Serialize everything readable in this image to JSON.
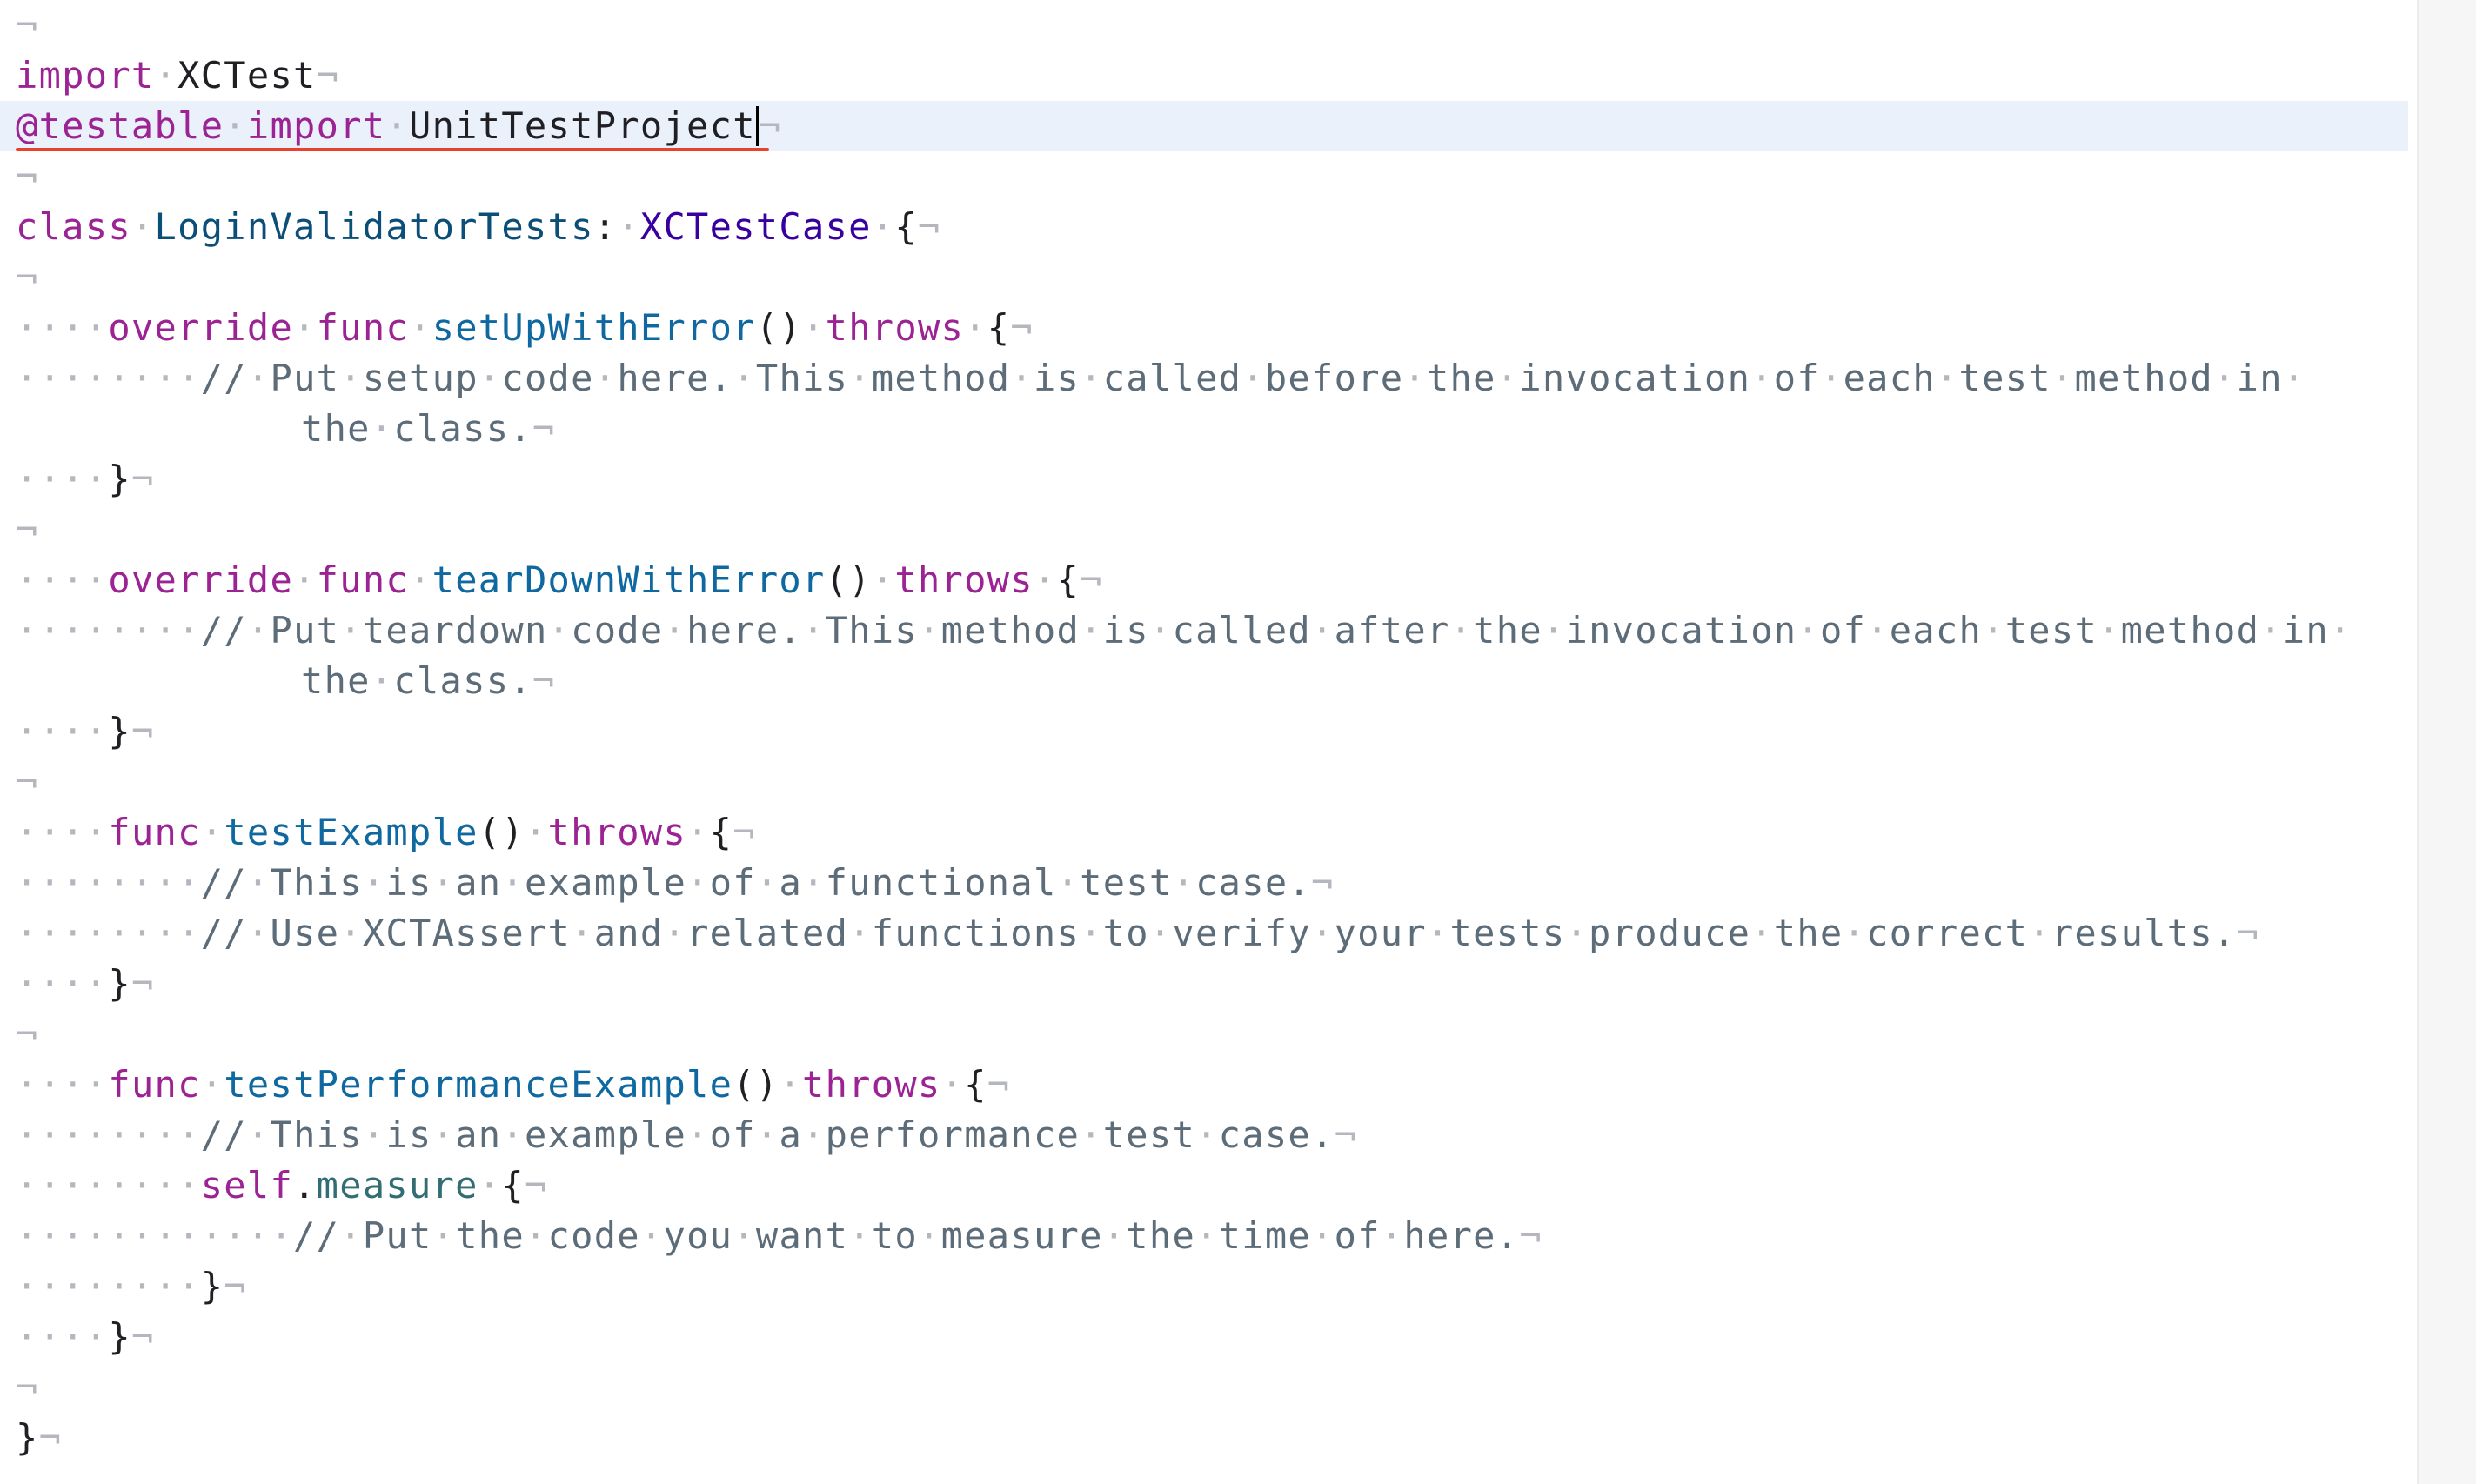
{
  "editor": {
    "file_lines": [
      {
        "id": "l0",
        "tokens": []
      },
      {
        "id": "l1",
        "tokens": [
          [
            "kw",
            "import"
          ],
          [
            "ws",
            "·"
          ],
          [
            "plain",
            "XCTest"
          ]
        ]
      },
      {
        "id": "l2",
        "tokens": [
          [
            "kw",
            "@testable"
          ],
          [
            "ws",
            "·"
          ],
          [
            "kw",
            "import"
          ],
          [
            "ws",
            "·"
          ],
          [
            "plain",
            "UnitTestProject"
          ]
        ],
        "current": true,
        "error": true
      },
      {
        "id": "l3",
        "tokens": []
      },
      {
        "id": "l4",
        "tokens": [
          [
            "kw",
            "class"
          ],
          [
            "ws",
            "·"
          ],
          [
            "ty",
            "LoginValidatorTests"
          ],
          [
            "plain",
            ":"
          ],
          [
            "ws",
            "·"
          ],
          [
            "sys",
            "XCTestCase"
          ],
          [
            "ws",
            "·"
          ],
          [
            "plain",
            "{"
          ]
        ]
      },
      {
        "id": "l5",
        "tokens": []
      },
      {
        "id": "l6",
        "tokens": [
          [
            "ws",
            "····"
          ],
          [
            "kw",
            "override"
          ],
          [
            "ws",
            "·"
          ],
          [
            "kw",
            "func"
          ],
          [
            "ws",
            "·"
          ],
          [
            "decl",
            "setUpWithError"
          ],
          [
            "plain",
            "()"
          ],
          [
            "ws",
            "·"
          ],
          [
            "kw",
            "throws"
          ],
          [
            "ws",
            "·"
          ],
          [
            "plain",
            "{"
          ]
        ]
      },
      {
        "id": "l7",
        "tokens": [
          [
            "ws",
            "········"
          ],
          [
            "cm",
            "//"
          ],
          [
            "ws",
            "·"
          ],
          [
            "cm",
            "Put"
          ],
          [
            "ws",
            "·"
          ],
          [
            "cm",
            "setup"
          ],
          [
            "ws",
            "·"
          ],
          [
            "cm",
            "code"
          ],
          [
            "ws",
            "·"
          ],
          [
            "cm",
            "here."
          ],
          [
            "ws",
            "·"
          ],
          [
            "cm",
            "This"
          ],
          [
            "ws",
            "·"
          ],
          [
            "cm",
            "method"
          ],
          [
            "ws",
            "·"
          ],
          [
            "cm",
            "is"
          ],
          [
            "ws",
            "·"
          ],
          [
            "cm",
            "called"
          ],
          [
            "ws",
            "·"
          ],
          [
            "cm",
            "before"
          ],
          [
            "ws",
            "·"
          ],
          [
            "cm",
            "the"
          ],
          [
            "ws",
            "·"
          ],
          [
            "cm",
            "invocation"
          ],
          [
            "ws",
            "·"
          ],
          [
            "cm",
            "of"
          ],
          [
            "ws",
            "·"
          ],
          [
            "cm",
            "each"
          ],
          [
            "ws",
            "·"
          ],
          [
            "cm",
            "test"
          ],
          [
            "ws",
            "·"
          ],
          [
            "cm",
            "method"
          ],
          [
            "ws",
            "·"
          ],
          [
            "cm",
            "in"
          ],
          [
            "ws",
            "·"
          ]
        ],
        "no_eol": true
      },
      {
        "id": "l7b",
        "tokens": [
          [
            "cm",
            "the"
          ],
          [
            "ws",
            "·"
          ],
          [
            "cm",
            "class."
          ]
        ],
        "wrapped": true
      },
      {
        "id": "l8",
        "tokens": [
          [
            "ws",
            "····"
          ],
          [
            "plain",
            "}"
          ]
        ]
      },
      {
        "id": "l9",
        "tokens": []
      },
      {
        "id": "l10",
        "tokens": [
          [
            "ws",
            "····"
          ],
          [
            "kw",
            "override"
          ],
          [
            "ws",
            "·"
          ],
          [
            "kw",
            "func"
          ],
          [
            "ws",
            "·"
          ],
          [
            "decl",
            "tearDownWithError"
          ],
          [
            "plain",
            "()"
          ],
          [
            "ws",
            "·"
          ],
          [
            "kw",
            "throws"
          ],
          [
            "ws",
            "·"
          ],
          [
            "plain",
            "{"
          ]
        ]
      },
      {
        "id": "l11",
        "tokens": [
          [
            "ws",
            "········"
          ],
          [
            "cm",
            "//"
          ],
          [
            "ws",
            "·"
          ],
          [
            "cm",
            "Put"
          ],
          [
            "ws",
            "·"
          ],
          [
            "cm",
            "teardown"
          ],
          [
            "ws",
            "·"
          ],
          [
            "cm",
            "code"
          ],
          [
            "ws",
            "·"
          ],
          [
            "cm",
            "here."
          ],
          [
            "ws",
            "·"
          ],
          [
            "cm",
            "This"
          ],
          [
            "ws",
            "·"
          ],
          [
            "cm",
            "method"
          ],
          [
            "ws",
            "·"
          ],
          [
            "cm",
            "is"
          ],
          [
            "ws",
            "·"
          ],
          [
            "cm",
            "called"
          ],
          [
            "ws",
            "·"
          ],
          [
            "cm",
            "after"
          ],
          [
            "ws",
            "·"
          ],
          [
            "cm",
            "the"
          ],
          [
            "ws",
            "·"
          ],
          [
            "cm",
            "invocation"
          ],
          [
            "ws",
            "·"
          ],
          [
            "cm",
            "of"
          ],
          [
            "ws",
            "·"
          ],
          [
            "cm",
            "each"
          ],
          [
            "ws",
            "·"
          ],
          [
            "cm",
            "test"
          ],
          [
            "ws",
            "·"
          ],
          [
            "cm",
            "method"
          ],
          [
            "ws",
            "·"
          ],
          [
            "cm",
            "in"
          ],
          [
            "ws",
            "·"
          ]
        ],
        "no_eol": true
      },
      {
        "id": "l11b",
        "tokens": [
          [
            "cm",
            "the"
          ],
          [
            "ws",
            "·"
          ],
          [
            "cm",
            "class."
          ]
        ],
        "wrapped": true
      },
      {
        "id": "l12",
        "tokens": [
          [
            "ws",
            "····"
          ],
          [
            "plain",
            "}"
          ]
        ]
      },
      {
        "id": "l13",
        "tokens": []
      },
      {
        "id": "l14",
        "tokens": [
          [
            "ws",
            "····"
          ],
          [
            "kw",
            "func"
          ],
          [
            "ws",
            "·"
          ],
          [
            "decl",
            "testExample"
          ],
          [
            "plain",
            "()"
          ],
          [
            "ws",
            "·"
          ],
          [
            "kw",
            "throws"
          ],
          [
            "ws",
            "·"
          ],
          [
            "plain",
            "{"
          ]
        ]
      },
      {
        "id": "l15",
        "tokens": [
          [
            "ws",
            "········"
          ],
          [
            "cm",
            "//"
          ],
          [
            "ws",
            "·"
          ],
          [
            "cm",
            "This"
          ],
          [
            "ws",
            "·"
          ],
          [
            "cm",
            "is"
          ],
          [
            "ws",
            "·"
          ],
          [
            "cm",
            "an"
          ],
          [
            "ws",
            "·"
          ],
          [
            "cm",
            "example"
          ],
          [
            "ws",
            "·"
          ],
          [
            "cm",
            "of"
          ],
          [
            "ws",
            "·"
          ],
          [
            "cm",
            "a"
          ],
          [
            "ws",
            "·"
          ],
          [
            "cm",
            "functional"
          ],
          [
            "ws",
            "·"
          ],
          [
            "cm",
            "test"
          ],
          [
            "ws",
            "·"
          ],
          [
            "cm",
            "case."
          ]
        ]
      },
      {
        "id": "l16",
        "tokens": [
          [
            "ws",
            "········"
          ],
          [
            "cm",
            "//"
          ],
          [
            "ws",
            "·"
          ],
          [
            "cm",
            "Use"
          ],
          [
            "ws",
            "·"
          ],
          [
            "cm",
            "XCTAssert"
          ],
          [
            "ws",
            "·"
          ],
          [
            "cm",
            "and"
          ],
          [
            "ws",
            "·"
          ],
          [
            "cm",
            "related"
          ],
          [
            "ws",
            "·"
          ],
          [
            "cm",
            "functions"
          ],
          [
            "ws",
            "·"
          ],
          [
            "cm",
            "to"
          ],
          [
            "ws",
            "·"
          ],
          [
            "cm",
            "verify"
          ],
          [
            "ws",
            "·"
          ],
          [
            "cm",
            "your"
          ],
          [
            "ws",
            "·"
          ],
          [
            "cm",
            "tests"
          ],
          [
            "ws",
            "·"
          ],
          [
            "cm",
            "produce"
          ],
          [
            "ws",
            "·"
          ],
          [
            "cm",
            "the"
          ],
          [
            "ws",
            "·"
          ],
          [
            "cm",
            "correct"
          ],
          [
            "ws",
            "·"
          ],
          [
            "cm",
            "results."
          ]
        ]
      },
      {
        "id": "l17",
        "tokens": [
          [
            "ws",
            "····"
          ],
          [
            "plain",
            "}"
          ]
        ]
      },
      {
        "id": "l18",
        "tokens": []
      },
      {
        "id": "l19",
        "tokens": [
          [
            "ws",
            "····"
          ],
          [
            "kw",
            "func"
          ],
          [
            "ws",
            "·"
          ],
          [
            "decl",
            "testPerformanceExample"
          ],
          [
            "plain",
            "()"
          ],
          [
            "ws",
            "·"
          ],
          [
            "kw",
            "throws"
          ],
          [
            "ws",
            "·"
          ],
          [
            "plain",
            "{"
          ]
        ]
      },
      {
        "id": "l20",
        "tokens": [
          [
            "ws",
            "········"
          ],
          [
            "cm",
            "//"
          ],
          [
            "ws",
            "·"
          ],
          [
            "cm",
            "This"
          ],
          [
            "ws",
            "·"
          ],
          [
            "cm",
            "is"
          ],
          [
            "ws",
            "·"
          ],
          [
            "cm",
            "an"
          ],
          [
            "ws",
            "·"
          ],
          [
            "cm",
            "example"
          ],
          [
            "ws",
            "·"
          ],
          [
            "cm",
            "of"
          ],
          [
            "ws",
            "·"
          ],
          [
            "cm",
            "a"
          ],
          [
            "ws",
            "·"
          ],
          [
            "cm",
            "performance"
          ],
          [
            "ws",
            "·"
          ],
          [
            "cm",
            "test"
          ],
          [
            "ws",
            "·"
          ],
          [
            "cm",
            "case."
          ]
        ]
      },
      {
        "id": "l21",
        "tokens": [
          [
            "ws",
            "········"
          ],
          [
            "kw",
            "self"
          ],
          [
            "plain",
            "."
          ],
          [
            "fn",
            "measure"
          ],
          [
            "ws",
            "·"
          ],
          [
            "plain",
            "{"
          ]
        ]
      },
      {
        "id": "l22",
        "tokens": [
          [
            "ws",
            "············"
          ],
          [
            "cm",
            "//"
          ],
          [
            "ws",
            "·"
          ],
          [
            "cm",
            "Put"
          ],
          [
            "ws",
            "·"
          ],
          [
            "cm",
            "the"
          ],
          [
            "ws",
            "·"
          ],
          [
            "cm",
            "code"
          ],
          [
            "ws",
            "·"
          ],
          [
            "cm",
            "you"
          ],
          [
            "ws",
            "·"
          ],
          [
            "cm",
            "want"
          ],
          [
            "ws",
            "·"
          ],
          [
            "cm",
            "to"
          ],
          [
            "ws",
            "·"
          ],
          [
            "cm",
            "measure"
          ],
          [
            "ws",
            "·"
          ],
          [
            "cm",
            "the"
          ],
          [
            "ws",
            "·"
          ],
          [
            "cm",
            "time"
          ],
          [
            "ws",
            "·"
          ],
          [
            "cm",
            "of"
          ],
          [
            "ws",
            "·"
          ],
          [
            "cm",
            "here."
          ]
        ]
      },
      {
        "id": "l23",
        "tokens": [
          [
            "ws",
            "········"
          ],
          [
            "plain",
            "}"
          ]
        ]
      },
      {
        "id": "l24",
        "tokens": [
          [
            "ws",
            "····"
          ],
          [
            "plain",
            "}"
          ]
        ]
      },
      {
        "id": "l25",
        "tokens": []
      },
      {
        "id": "l26",
        "tokens": [
          [
            "plain",
            "}"
          ]
        ]
      }
    ],
    "eol_glyph": "¬",
    "colors": {
      "keyword": "#9b2393",
      "type": "#0b4f79",
      "system_type": "#3900a0",
      "declaration": "#0f68a0",
      "function": "#326d74",
      "comment": "#5d6c79",
      "invisibles": "#b4b7bd",
      "current_line": "#ebf1fb",
      "error_underline": "#e8412c"
    }
  }
}
